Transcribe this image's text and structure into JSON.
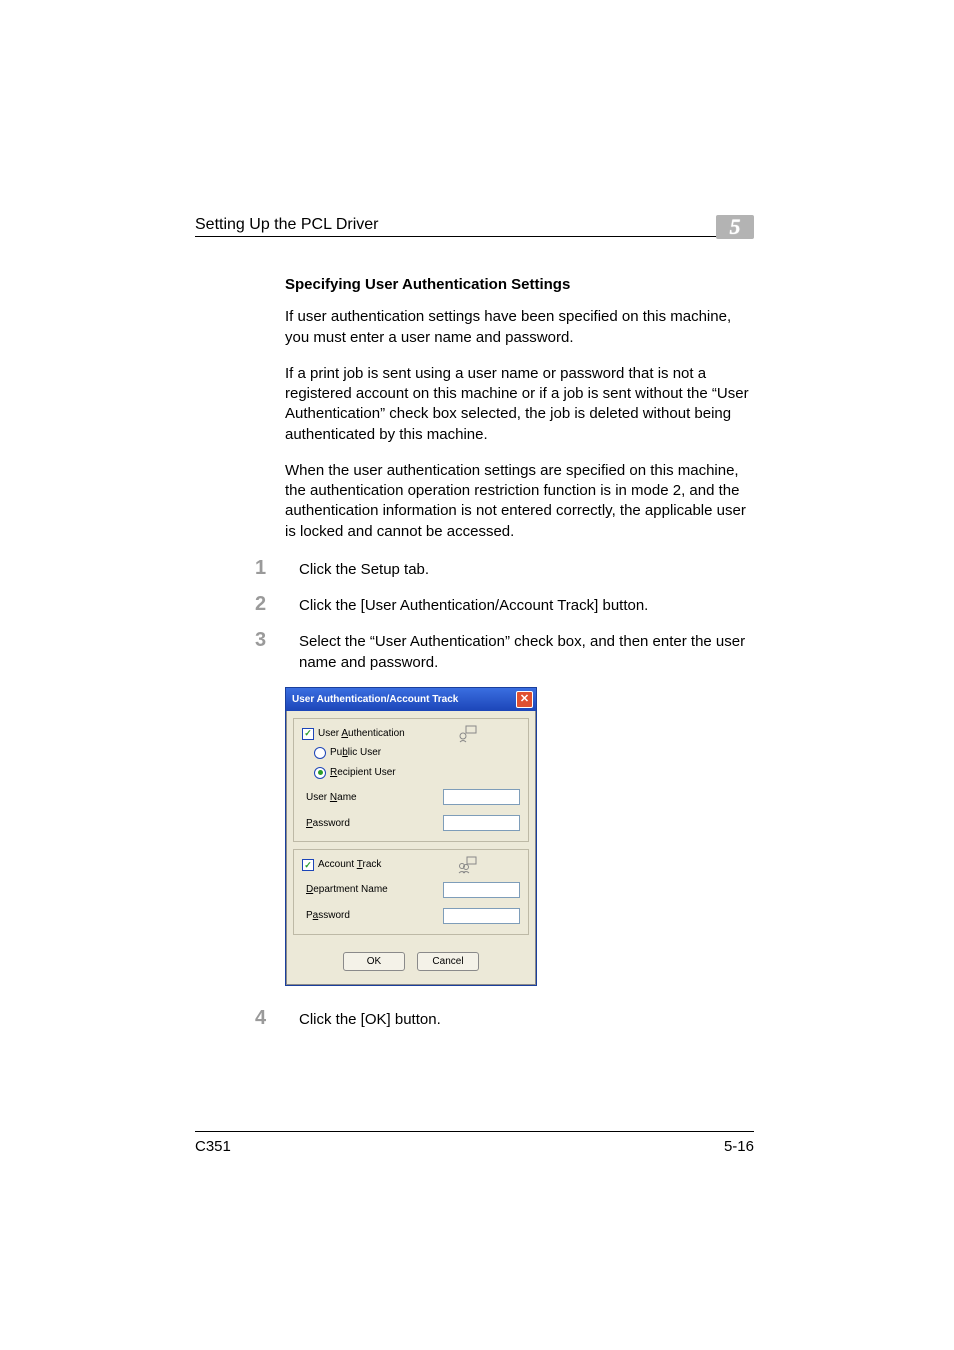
{
  "header": {
    "running_title": "Setting Up the PCL Driver",
    "chapter_number": "5"
  },
  "section": {
    "subheading": "Specifying User Authentication Settings",
    "paragraphs": [
      "If user authentication settings have been specified on this machine, you must enter a user name and password.",
      "If a print job is sent using a user name or password that is not a registered account on this machine or if a job is sent without the “User Authentication” check box selected, the job is deleted without being authenticated by this machine.",
      "When the user authentication settings are specified on this machine, the authentication operation restriction function is in mode 2, and the authentication information is not entered correctly, the applicable user is locked and cannot be accessed."
    ],
    "steps": {
      "one": {
        "num": "1",
        "text": "Click the Setup tab."
      },
      "two": {
        "num": "2",
        "text": "Click the [User Authentication/Account Track] button."
      },
      "three": {
        "num": "3",
        "text": "Select the “User Authentication” check box, and then enter the user name and password."
      },
      "four": {
        "num": "4",
        "text": "Click the [OK] button."
      }
    }
  },
  "dialog": {
    "title": "User Authentication/Account Track",
    "close_glyph": "✕",
    "user_auth": {
      "checkbox_label_prefix": "User ",
      "checkbox_label_u": "A",
      "checkbox_label_suffix": "uthentication",
      "check_glyph": "✓",
      "public_user_prefix": "Pu",
      "public_user_u": "b",
      "public_user_suffix": "lic User",
      "recipient_user_u": "R",
      "recipient_user_suffix": "ecipient User",
      "user_name_prefix": "User ",
      "user_name_u": "N",
      "user_name_suffix": "ame",
      "password_u": "P",
      "password_suffix": "assword"
    },
    "account_track": {
      "checkbox_label_prefix": "Account ",
      "checkbox_label_u": "T",
      "checkbox_label_suffix": "rack",
      "check_glyph": "✓",
      "dept_u": "D",
      "dept_suffix": "epartment Name",
      "password_prefix": "P",
      "password_u": "a",
      "password_suffix": "ssword"
    },
    "buttons": {
      "ok": "OK",
      "cancel": "Cancel"
    }
  },
  "footer": {
    "model": "C351",
    "page_number": "5-16"
  }
}
